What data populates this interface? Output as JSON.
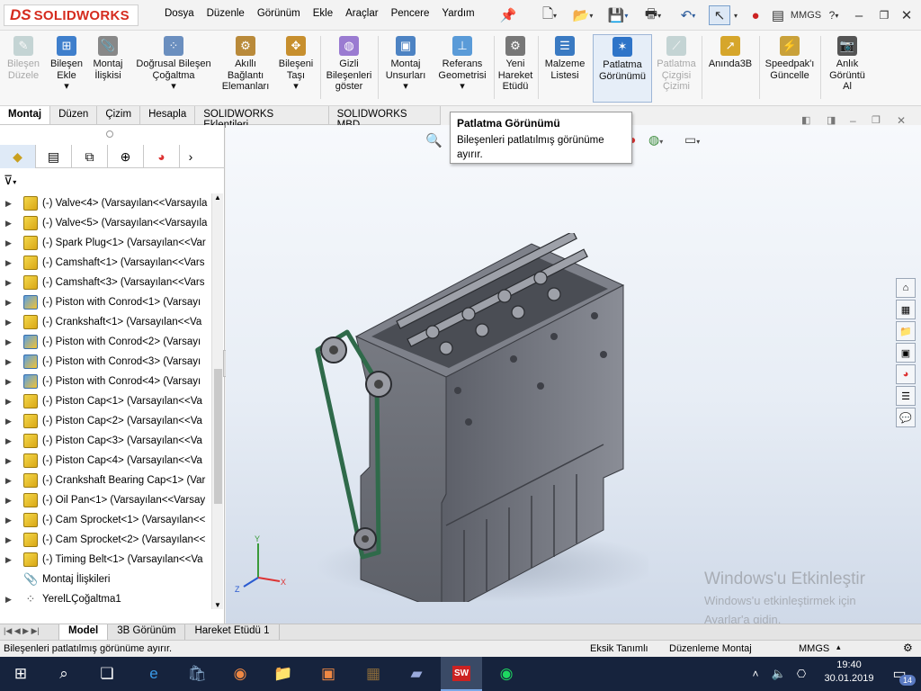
{
  "app": {
    "logo_ds": "DS",
    "logo_name": "SOLIDWORKS"
  },
  "menu": [
    "Dosya",
    "Düzenle",
    "Görünüm",
    "Ekle",
    "Araçlar",
    "Pencere",
    "Yardım"
  ],
  "quick_access": {
    "mmgs": "MMGS",
    "help": "?"
  },
  "ribbon": [
    {
      "l1": "Bileşen",
      "l2": "Düzele",
      "l3": "",
      "enabled": false,
      "icon": "edit-component-icon"
    },
    {
      "l1": "Bileşen",
      "l2": "Ekle",
      "l3": "▾",
      "enabled": true,
      "icon": "insert-component-icon"
    },
    {
      "l1": "Montaj",
      "l2": "İlişkisi",
      "l3": "",
      "enabled": true,
      "icon": "mate-icon"
    },
    {
      "l1": "Doğrusal Bileşen",
      "l2": "Çoğaltma",
      "l3": "▾",
      "enabled": true,
      "icon": "linear-pattern-icon"
    },
    {
      "l1": "Akıllı",
      "l2": "Bağlantı",
      "l3": "Elemanları",
      "enabled": true,
      "icon": "smart-fasteners-icon"
    },
    {
      "l1": "Bileşeni",
      "l2": "Taşı",
      "l3": "▾",
      "enabled": true,
      "icon": "move-component-icon"
    },
    {
      "l1": "Gizli",
      "l2": "Bileşenleri",
      "l3": "göster",
      "enabled": true,
      "icon": "show-hidden-icon"
    },
    {
      "l1": "Montaj",
      "l2": "Unsurları",
      "l3": "▾",
      "enabled": true,
      "icon": "assembly-features-icon"
    },
    {
      "l1": "Referans",
      "l2": "Geometrisi",
      "l3": "▾",
      "enabled": true,
      "icon": "reference-geometry-icon"
    },
    {
      "l1": "Yeni",
      "l2": "Hareket",
      "l3": "Etüdü",
      "enabled": true,
      "icon": "new-motion-study-icon"
    },
    {
      "l1": "Malzeme",
      "l2": "Listesi",
      "l3": "",
      "enabled": true,
      "icon": "bill-of-materials-icon"
    },
    {
      "l1": "Patlatma",
      "l2": "Görünümü",
      "l3": "",
      "enabled": true,
      "icon": "exploded-view-icon"
    },
    {
      "l1": "Patlatma",
      "l2": "Çizgisi",
      "l3": "Çizimi",
      "enabled": false,
      "icon": "explode-line-icon"
    },
    {
      "l1": "Anında3B",
      "l2": "",
      "l3": "",
      "enabled": true,
      "icon": "instant3d-icon"
    },
    {
      "l1": "Speedpak'ı",
      "l2": "Güncelle",
      "l3": "",
      "enabled": true,
      "icon": "speedpak-icon"
    },
    {
      "l1": "Anlık",
      "l2": "Görüntü",
      "l3": "Al",
      "enabled": true,
      "icon": "snapshot-icon"
    }
  ],
  "command_tabs": [
    "Montaj",
    "Düzen",
    "Çizim",
    "Hesapla",
    "SOLIDWORKS Eklentileri",
    "SOLIDWORKS MBD"
  ],
  "tooltip": {
    "title": "Patlatma Görünümü",
    "text": "Bileşenleri patlatılmış görünüme ayırır."
  },
  "feature_tree": [
    {
      "label": "(-) Valve<4> (Varsayılan<<Varsayıla",
      "type": "part"
    },
    {
      "label": "(-) Valve<5> (Varsayılan<<Varsayıla",
      "type": "part"
    },
    {
      "label": "(-) Spark Plug<1> (Varsayılan<<Var",
      "type": "part"
    },
    {
      "label": "(-) Camshaft<1> (Varsayılan<<Vars",
      "type": "part"
    },
    {
      "label": "(-) Camshaft<3> (Varsayılan<<Vars",
      "type": "part"
    },
    {
      "label": "(-) Piston with Conrod<1> (Varsayı",
      "type": "asm"
    },
    {
      "label": "(-) Crankshaft<1> (Varsayılan<<Va",
      "type": "part"
    },
    {
      "label": "(-) Piston with Conrod<2> (Varsayı",
      "type": "asm"
    },
    {
      "label": "(-) Piston with Conrod<3> (Varsayı",
      "type": "asm"
    },
    {
      "label": "(-) Piston with Conrod<4> (Varsayı",
      "type": "asm"
    },
    {
      "label": "(-) Piston Cap<1> (Varsayılan<<Va",
      "type": "part"
    },
    {
      "label": "(-) Piston Cap<2> (Varsayılan<<Va",
      "type": "part"
    },
    {
      "label": "(-) Piston Cap<3> (Varsayılan<<Va",
      "type": "part"
    },
    {
      "label": "(-) Piston Cap<4> (Varsayılan<<Va",
      "type": "part"
    },
    {
      "label": "(-) Crankshaft Bearing Cap<1> (Var",
      "type": "part"
    },
    {
      "label": "(-) Oil Pan<1> (Varsayılan<<Varsay",
      "type": "part"
    },
    {
      "label": "(-) Cam Sprocket<1> (Varsayılan<<",
      "type": "part"
    },
    {
      "label": "(-) Cam Sprocket<2> (Varsayılan<<",
      "type": "part"
    },
    {
      "label": "(-) Timing Belt<1> (Varsayılan<<Va",
      "type": "part"
    },
    {
      "label": "Montaj İlişkileri",
      "type": "mate"
    },
    {
      "label": "YerelLÇoğaltma1",
      "type": "pattern"
    }
  ],
  "model_tabs": [
    "Model",
    "3B Görünüm",
    "Hareket Etüdü 1"
  ],
  "status": {
    "message": "Bileşenleri patlatılmış görünüme ayırır.",
    "state": "Eksik Tanımlı",
    "mode": "Düzenleme Montaj",
    "units": "MMGS"
  },
  "watermark": {
    "line1": "Windows'u Etkinleştir",
    "line2": "Windows'u etkinleştirmek için Ayarlar'a gidin."
  },
  "taskbar": {
    "time": "19:40",
    "date": "30.01.2019",
    "notifications": "14",
    "sw_label": "SW"
  }
}
